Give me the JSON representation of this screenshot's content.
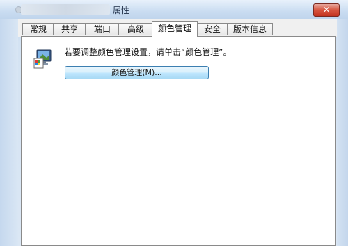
{
  "window": {
    "title": "属性",
    "close_symbol": "✕",
    "icon": "printer-icon"
  },
  "tabs": [
    {
      "label": "常规"
    },
    {
      "label": "共享"
    },
    {
      "label": "端口"
    },
    {
      "label": "高级"
    },
    {
      "label": "颜色管理",
      "active": true
    },
    {
      "label": "安全"
    },
    {
      "label": "版本信息"
    }
  ],
  "color_management": {
    "icon": "color-management-icon",
    "info_text": "若要调整颜色管理设置，请单击“颜色管理”。",
    "button_label": "颜色管理(M)..."
  },
  "colors": {
    "title_bar": "#c9dcf1",
    "close_button": "#c2331f",
    "button_border": "#3c7fb1"
  }
}
